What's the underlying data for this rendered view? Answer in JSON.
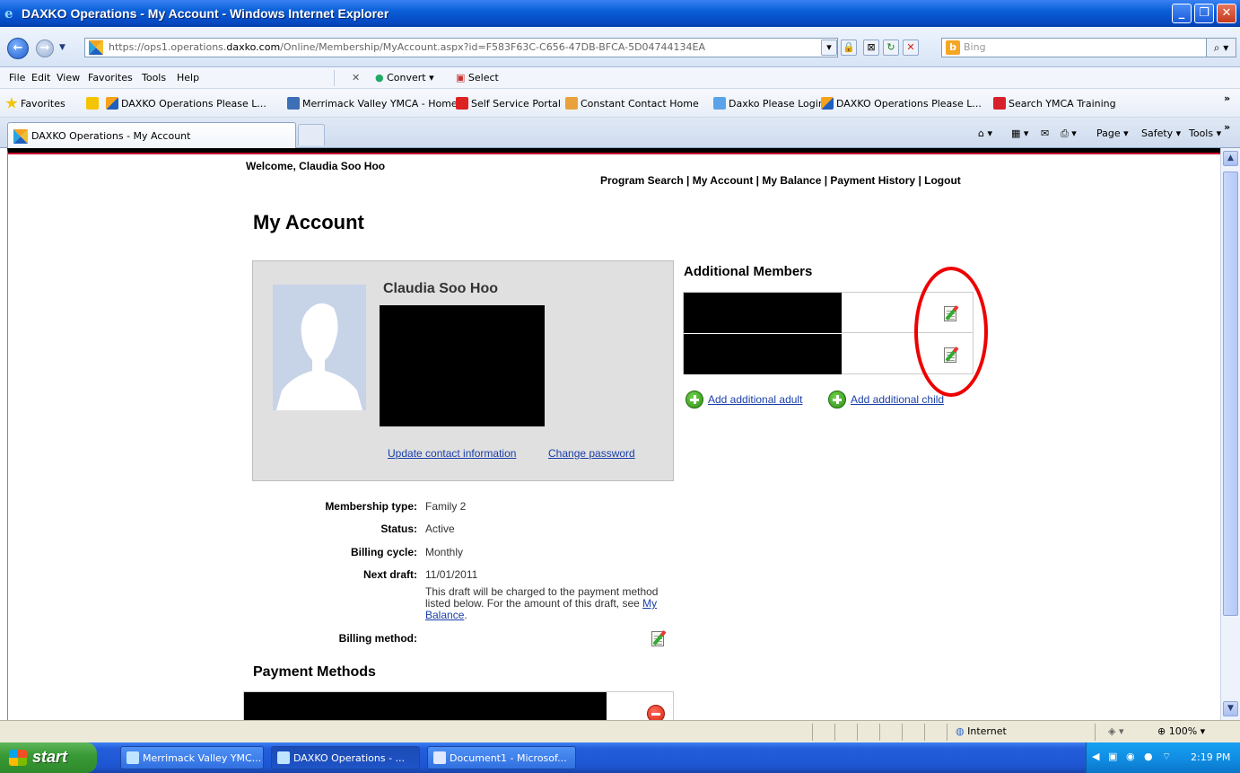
{
  "window": {
    "title": "DAXKO Operations - My Account - Windows Internet Explorer"
  },
  "browser": {
    "url_prefix": "https://ops1.operations.",
    "url_domain": "daxko.com",
    "url_path": "/Online/Membership/MyAccount.aspx?id=F583F63C-C656-47DB-BFCA-5D04744134EA",
    "search_placeholder": "Bing",
    "menu": [
      "File",
      "Edit",
      "View",
      "Favorites",
      "Tools",
      "Help"
    ],
    "toolbar_convert": "Convert",
    "toolbar_select": "Select",
    "favorites_label": "Favorites",
    "favorites": [
      "DAXKO Operations Please L...",
      "Merrimack Valley YMCA - Home",
      "Self Service Portal",
      "Constant Contact Home",
      "Daxko Please Login",
      "DAXKO Operations Please L...",
      "Search YMCA Training"
    ],
    "active_tab": "DAXKO Operations - My Account",
    "commands": [
      "Page",
      "Safety",
      "Tools"
    ]
  },
  "page": {
    "welcome": "Welcome, Claudia Soo Hoo",
    "nav": [
      "Program Search",
      "My Account",
      "My Balance",
      "Payment History",
      "Logout"
    ],
    "title": "My Account",
    "profile": {
      "name": "Claudia Soo Hoo",
      "update_link": "Update contact information",
      "change_pw_link": "Change password"
    },
    "details": [
      {
        "label": "Membership type:",
        "value": "Family 2"
      },
      {
        "label": "Status:",
        "value": "Active"
      },
      {
        "label": "Billing cycle:",
        "value": "Monthly"
      },
      {
        "label": "Next draft:",
        "value": "11/01/2011"
      }
    ],
    "draft_note": "This draft will be charged to the payment method listed below. For the amount of this draft, see ",
    "draft_note_link": "My Balance",
    "draft_note_end": ".",
    "billing_method_label": "Billing method:",
    "payment_methods_title": "Payment Methods",
    "additional_members_title": "Additional Members",
    "add_adult": "Add additional adult",
    "add_child": "Add additional child"
  },
  "status": {
    "zone": "Internet",
    "zoom": "100%"
  },
  "taskbar": {
    "start": "start",
    "tasks": [
      "Merrimack Valley YMC...",
      "DAXKO Operations - ...",
      "Document1 - Microsof..."
    ],
    "clock": "2:19 PM"
  }
}
